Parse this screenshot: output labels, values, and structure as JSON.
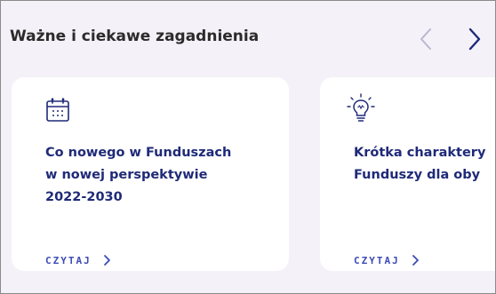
{
  "section": {
    "title": "Ważne i ciekawe zagadnienia"
  },
  "navigation": {
    "prev_icon": "chevron-left-icon",
    "next_icon": "chevron-right-icon"
  },
  "cards": [
    {
      "icon": "calendar-icon",
      "title_lines": [
        "Co nowego w Funduszach",
        "w nowej perspektywie",
        "2022-2030"
      ],
      "link_label": "CZYTAJ"
    },
    {
      "icon": "lightbulb-icon",
      "title_lines": [
        "Krótka charaktery",
        "Funduszy dla oby"
      ],
      "link_label": "CZYTAJ"
    }
  ],
  "colors": {
    "background": "#f4f1f8",
    "card": "#ffffff",
    "card_title": "#1f2a78",
    "link": "#3c4bb4",
    "arrow_active": "#1f2a78",
    "arrow_inactive": "#b8b8d0"
  }
}
